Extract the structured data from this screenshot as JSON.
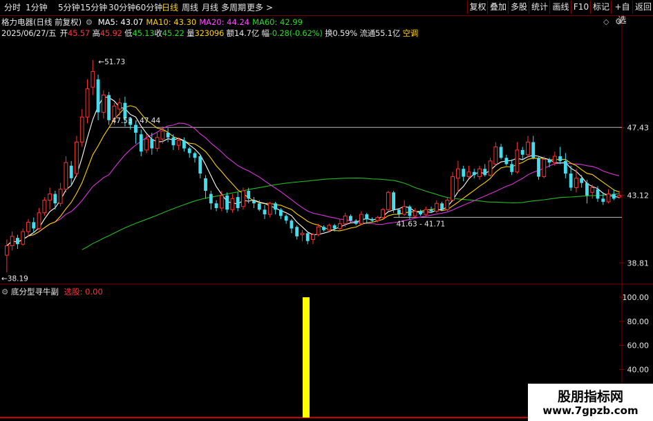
{
  "toolbar": {
    "periods": [
      {
        "label": "分时",
        "active": false
      },
      {
        "label": "1分钟",
        "active": false
      },
      {
        "label": "5分钟",
        "active": false
      },
      {
        "label": "15分钟",
        "active": false
      },
      {
        "label": "30分钟",
        "active": false
      },
      {
        "label": "60分钟",
        "active": false
      },
      {
        "label": "日线",
        "active": true
      },
      {
        "label": "周线",
        "active": false
      },
      {
        "label": "月线",
        "active": false
      },
      {
        "label": "多周期",
        "active": false
      },
      {
        "label": "更多 >",
        "active": false
      }
    ],
    "right_buttons": [
      "复权",
      "叠加",
      "多股",
      "统计",
      "画线",
      "F10",
      "标记",
      "+自选",
      "返回"
    ]
  },
  "header": {
    "stock_name": "格力电器(日线 前复权)",
    "ma": [
      {
        "label": "MA5: 43.07",
        "color": "#ffffff"
      },
      {
        "label": "MA10: 43.30",
        "color": "#ffd200"
      },
      {
        "label": "MA20: 44.24",
        "color": "#ff44ff"
      },
      {
        "label": "MA60: 42.99",
        "color": "#22dd22"
      }
    ],
    "quote": {
      "date": "2025/06/27/五",
      "open_label": "开",
      "open": "45.57",
      "high_label": "高",
      "high": "45.92",
      "low_label": "低",
      "low": "45.13",
      "close_label": "收",
      "close": "45.22",
      "vol_label": "量",
      "vol": "323096",
      "amount_label": "额",
      "amount": "14.7亿",
      "change_label": "幅",
      "change": "-0.28(-0.62%)",
      "turnover_label": "换",
      "turnover": "0.59%",
      "float_label": "流通",
      "float": "55.1亿",
      "status": "空调"
    }
  },
  "price_axis": [
    "47.43",
    "43.12",
    "38.81"
  ],
  "annotations": {
    "high": "51.73",
    "low": "38.19",
    "range1": "47.53 - 47.44",
    "range2": "41.63 - 41.71"
  },
  "indicator": {
    "name": "底分型寻牛副",
    "param_label": "选股: 0.00",
    "axis": [
      "100.00",
      "80.00",
      "60.00",
      "40.00"
    ]
  },
  "watermark": {
    "line1": "股朋指标网",
    "line2": "www.7gpzb.com"
  },
  "colors": {
    "up": "#ff3333",
    "down": "#44ddee",
    "ma5": "#ffffff",
    "ma10": "#ffd200",
    "ma20": "#dd33dd",
    "ma60": "#22bb22",
    "grid": "#7a0000",
    "signal": "#ffff00"
  },
  "chart_data": {
    "type": "candlestick",
    "ylim": [
      37.5,
      53.0
    ],
    "candles": [
      [
        39.3,
        39.9,
        38.2,
        40.3
      ],
      [
        39.9,
        40.5,
        39.6,
        40.8
      ],
      [
        40.4,
        40.0,
        39.7,
        40.6
      ],
      [
        40.0,
        40.8,
        39.9,
        41.0
      ],
      [
        40.8,
        41.4,
        40.5,
        41.6
      ],
      [
        41.4,
        41.0,
        40.7,
        41.7
      ],
      [
        41.0,
        42.0,
        40.9,
        42.3
      ],
      [
        42.0,
        42.8,
        41.8,
        43.0
      ],
      [
        42.8,
        43.2,
        42.2,
        43.6
      ],
      [
        43.2,
        42.6,
        42.2,
        43.4
      ],
      [
        42.6,
        43.5,
        42.4,
        43.9
      ],
      [
        43.5,
        45.2,
        43.3,
        45.6
      ],
      [
        45.0,
        44.2,
        43.7,
        45.3
      ],
      [
        44.5,
        46.5,
        44.3,
        46.9
      ],
      [
        46.5,
        48.1,
        46.2,
        48.6
      ],
      [
        48.1,
        49.9,
        47.7,
        50.5
      ],
      [
        50.0,
        51.0,
        49.5,
        51.73
      ],
      [
        50.5,
        48.4,
        47.9,
        50.8
      ],
      [
        48.4,
        49.5,
        48.0,
        49.8
      ],
      [
        49.5,
        47.9,
        47.6,
        49.7
      ],
      [
        48.0,
        48.8,
        47.6,
        49.0
      ],
      [
        48.6,
        49.0,
        48.2,
        49.3
      ],
      [
        49.0,
        48.0,
        47.5,
        49.4
      ],
      [
        48.0,
        47.6,
        47.3,
        48.1
      ],
      [
        47.6,
        47.1,
        46.4,
        47.8
      ],
      [
        47.0,
        45.9,
        45.6,
        47.3
      ],
      [
        46.0,
        46.7,
        45.8,
        47.0
      ],
      [
        46.7,
        46.1,
        45.7,
        47.1
      ],
      [
        46.1,
        46.8,
        45.9,
        47.1
      ],
      [
        46.7,
        47.2,
        46.4,
        47.5
      ],
      [
        47.1,
        46.8,
        46.5,
        47.4
      ],
      [
        46.8,
        46.3,
        46.0,
        47.0
      ],
      [
        46.3,
        46.6,
        46.0,
        46.8
      ],
      [
        46.6,
        46.1,
        45.9,
        46.8
      ],
      [
        46.1,
        45.8,
        45.5,
        46.2
      ],
      [
        45.8,
        45.5,
        45.2,
        45.9
      ],
      [
        45.6,
        44.5,
        44.2,
        45.7
      ],
      [
        44.2,
        43.4,
        42.9,
        44.4
      ],
      [
        43.2,
        42.6,
        42.2,
        43.4
      ],
      [
        42.6,
        42.3,
        42.1,
        42.8
      ],
      [
        42.3,
        43.1,
        42.1,
        43.4
      ],
      [
        43.1,
        42.2,
        42.0,
        43.3
      ],
      [
        42.2,
        42.9,
        42.0,
        43.2
      ],
      [
        43.0,
        42.3,
        42.1,
        43.3
      ],
      [
        42.4,
        43.4,
        42.2,
        43.6
      ],
      [
        43.4,
        42.9,
        42.6,
        43.6
      ],
      [
        42.8,
        42.6,
        42.3,
        43.0
      ],
      [
        42.6,
        42.2,
        42.1,
        42.8
      ],
      [
        42.2,
        41.9,
        41.6,
        42.5
      ],
      [
        41.9,
        42.6,
        41.7,
        42.7
      ],
      [
        42.6,
        42.2,
        41.9,
        42.7
      ],
      [
        42.2,
        41.8,
        41.6,
        42.3
      ],
      [
        41.8,
        41.5,
        41.3,
        41.9
      ],
      [
        41.5,
        41.0,
        40.7,
        41.6
      ],
      [
        41.1,
        40.5,
        40.3,
        41.2
      ],
      [
        40.6,
        40.7,
        40.2,
        40.9
      ],
      [
        40.7,
        40.2,
        40.0,
        40.8
      ],
      [
        40.3,
        40.6,
        40.0,
        40.7
      ],
      [
        40.6,
        41.1,
        40.5,
        41.3
      ],
      [
        41.1,
        40.9,
        40.8,
        41.2
      ],
      [
        40.9,
        41.2,
        40.8,
        41.3
      ],
      [
        41.2,
        41.0,
        40.8,
        41.3
      ],
      [
        41.0,
        41.3,
        40.9,
        41.6
      ],
      [
        41.3,
        41.8,
        41.1,
        42.0
      ],
      [
        41.8,
        41.5,
        41.4,
        41.9
      ],
      [
        41.5,
        41.3,
        41.2,
        41.6
      ],
      [
        41.3,
        41.9,
        41.2,
        42.1
      ],
      [
        41.9,
        41.6,
        41.3,
        42.0
      ],
      [
        41.6,
        41.5,
        41.4,
        41.7
      ],
      [
        41.5,
        41.7,
        41.4,
        41.8
      ],
      [
        41.7,
        42.2,
        41.6,
        42.3
      ],
      [
        42.2,
        43.3,
        42.1,
        43.4
      ],
      [
        43.3,
        42.2,
        42.0,
        43.4
      ],
      [
        42.2,
        41.9,
        41.7,
        42.3
      ],
      [
        41.9,
        42.4,
        41.8,
        42.8
      ],
      [
        42.4,
        41.8,
        41.6,
        42.5
      ],
      [
        41.8,
        42.1,
        41.7,
        42.3
      ],
      [
        42.1,
        41.9,
        41.8,
        42.2
      ],
      [
        41.9,
        42.2,
        41.8,
        42.4
      ],
      [
        42.2,
        42.1,
        42.0,
        42.4
      ],
      [
        42.1,
        42.6,
        42.0,
        42.8
      ],
      [
        42.6,
        42.2,
        42.1,
        42.7
      ],
      [
        42.2,
        42.8,
        42.1,
        43.0
      ],
      [
        42.8,
        44.3,
        42.7,
        44.6
      ],
      [
        44.2,
        44.8,
        43.3,
        45.3
      ],
      [
        44.8,
        44.3,
        44.0,
        45.0
      ],
      [
        44.3,
        44.6,
        44.2,
        45.0
      ],
      [
        44.6,
        44.4,
        44.2,
        44.8
      ],
      [
        44.3,
        44.8,
        44.1,
        45.0
      ],
      [
        44.8,
        44.4,
        44.3,
        45.1
      ],
      [
        44.4,
        45.3,
        44.3,
        45.5
      ],
      [
        45.1,
        46.2,
        45.0,
        46.5
      ],
      [
        46.2,
        45.5,
        45.4,
        46.4
      ],
      [
        45.5,
        45.1,
        45.0,
        45.7
      ],
      [
        45.1,
        44.6,
        44.4,
        45.4
      ],
      [
        44.6,
        46.0,
        44.5,
        46.5
      ],
      [
        46.0,
        45.7,
        45.4,
        46.2
      ],
      [
        45.7,
        46.5,
        45.5,
        46.9
      ],
      [
        46.5,
        45.5,
        45.4,
        46.9
      ],
      [
        45.5,
        44.3,
        44.1,
        45.6
      ],
      [
        44.3,
        45.4,
        44.2,
        45.6
      ],
      [
        45.4,
        45.2,
        44.9,
        45.5
      ],
      [
        45.2,
        45.6,
        45.0,
        45.9
      ],
      [
        45.6,
        45.3,
        45.1,
        46.2
      ],
      [
        45.3,
        44.5,
        44.2,
        45.8
      ],
      [
        44.5,
        43.6,
        43.4,
        45.0
      ],
      [
        43.6,
        44.2,
        43.3,
        44.8
      ],
      [
        44.2,
        43.9,
        43.6,
        44.4
      ],
      [
        43.9,
        43.1,
        42.6,
        44.1
      ],
      [
        43.3,
        43.6,
        42.9,
        43.8
      ],
      [
        43.5,
        42.9,
        42.7,
        43.7
      ],
      [
        42.9,
        42.7,
        42.5,
        43.3
      ],
      [
        42.7,
        43.2,
        42.6,
        43.5
      ],
      [
        43.2,
        42.9,
        42.8,
        43.5
      ],
      [
        43.0,
        43.1,
        42.9,
        43.4
      ]
    ],
    "indicator_signal_bar_index": 54,
    "indicator_signal_value": 100.0
  }
}
